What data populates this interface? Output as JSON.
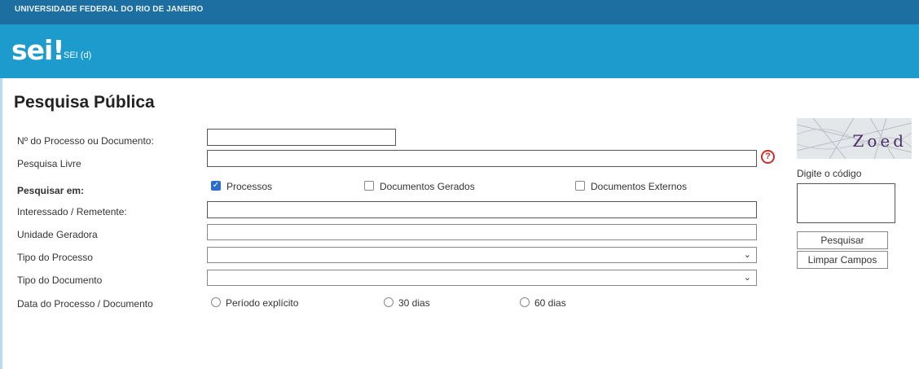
{
  "header": {
    "organization": "UNIVERSIDADE FEDERAL DO RIO DE JANEIRO",
    "logo": "sei!",
    "system": "SEI (d)"
  },
  "page": {
    "title": "Pesquisa Pública"
  },
  "form": {
    "numero_label": "Nº do Processo ou Documento:",
    "pesquisa_livre_label": "Pesquisa Livre",
    "pesquisar_em_label": "Pesquisar em:",
    "pesquisar_em_options": [
      "Processos",
      "Documentos Gerados",
      "Documentos Externos"
    ],
    "interessado_label": "Interessado / Remetente:",
    "unidade_label": "Unidade Geradora",
    "tipo_processo_label": "Tipo do Processo",
    "tipo_documento_label": "Tipo do Documento",
    "data_label": "Data do Processo / Documento",
    "data_options": [
      "Período explícito",
      "30 dias",
      "60 dias"
    ],
    "help_icon": "?"
  },
  "captcha": {
    "text": "Zoed",
    "digite_label": "Digite o código"
  },
  "buttons": {
    "pesquisar": "Pesquisar",
    "limpar": "Limpar Campos"
  }
}
